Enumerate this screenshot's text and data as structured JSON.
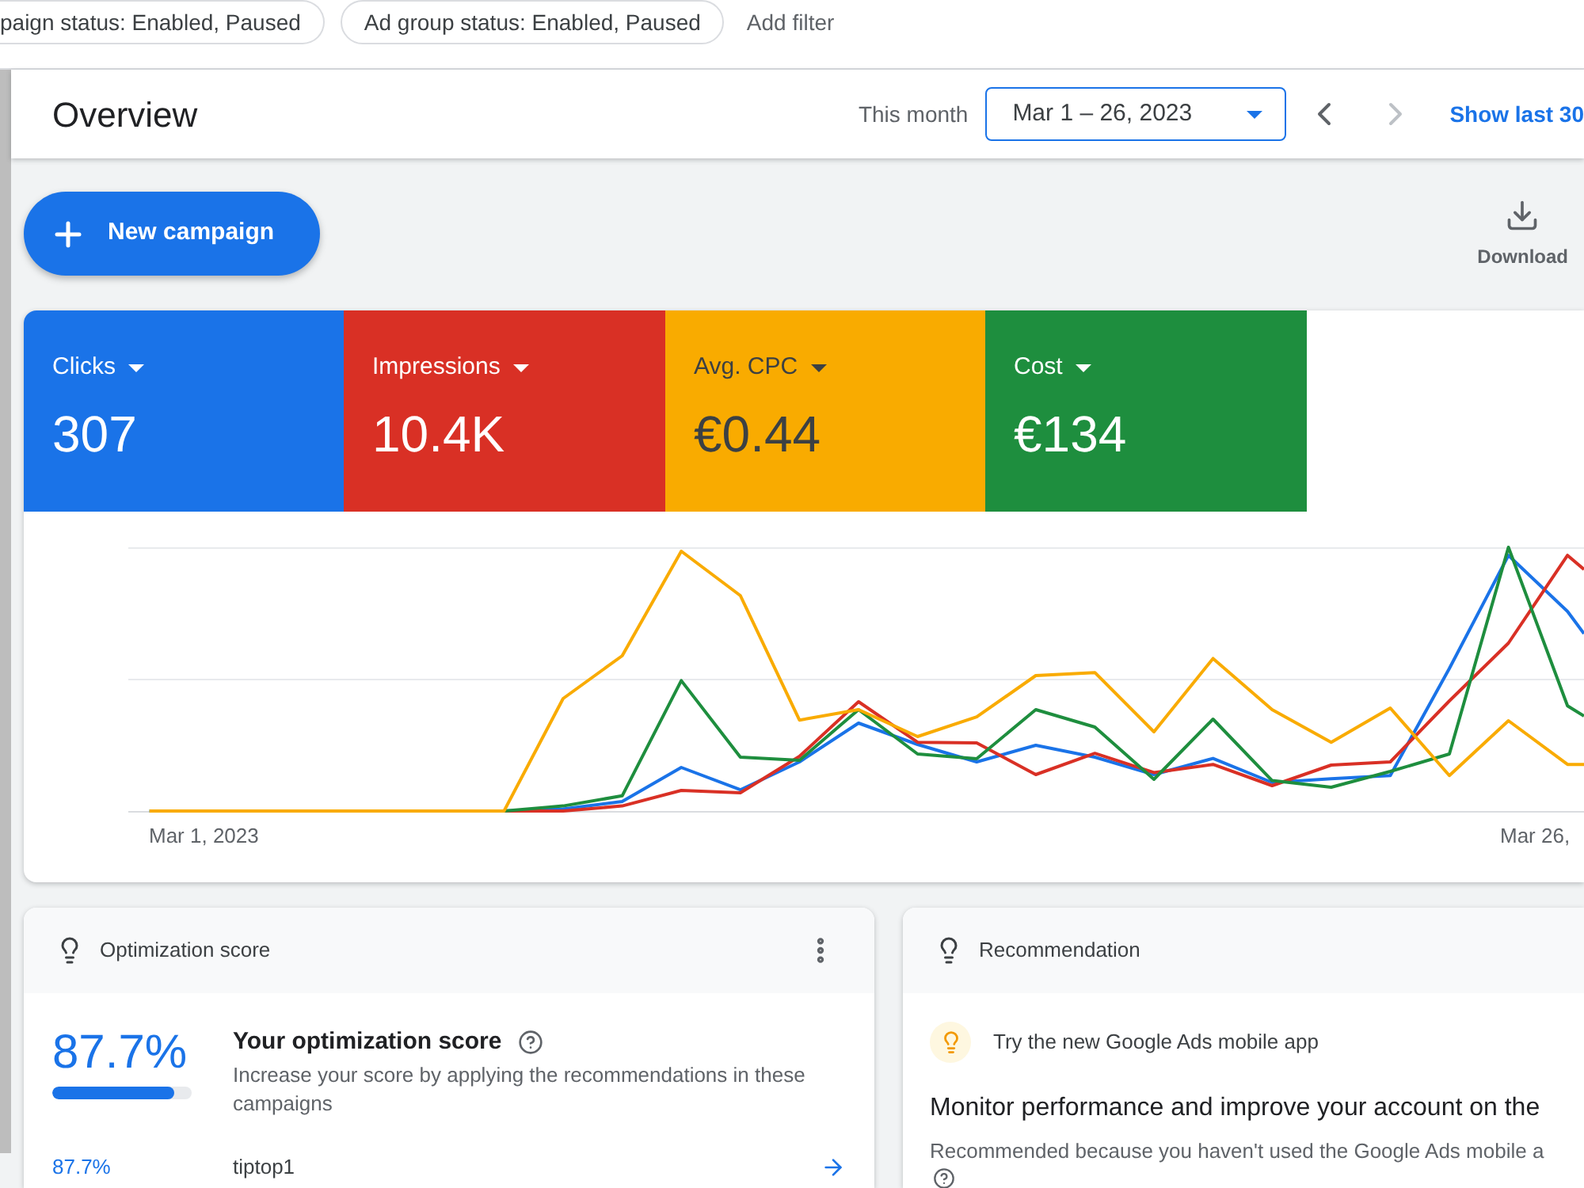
{
  "filters": [
    {
      "label": "paign status: Enabled, Paused"
    },
    {
      "label": "Ad group status: Enabled, Paused"
    }
  ],
  "add_filter": "Add filter",
  "header": {
    "title": "Overview",
    "range_label": "This month",
    "date_range": "Mar 1 – 26, 2023",
    "prev_disabled": false,
    "next_disabled": true,
    "show_last": "Show last 30"
  },
  "toolbar": {
    "new_campaign": "New campaign",
    "download": "Download"
  },
  "metrics": [
    {
      "label": "Clicks",
      "value": "307",
      "color": "#1a73e8",
      "selected": true
    },
    {
      "label": "Impressions",
      "value": "10.4K",
      "color": "#d93025",
      "selected": true
    },
    {
      "label": "Avg. CPC",
      "value": "€0.44",
      "color": "#f9ab00",
      "selected": true
    },
    {
      "label": "Cost",
      "value": "€134",
      "color": "#1e8e3e",
      "selected": true
    }
  ],
  "chart": {
    "x_labels": [
      "Mar 1, 2023",
      "Mar 26,"
    ]
  },
  "optimization_card": {
    "title": "Optimization score",
    "score": "87.7%",
    "level": 0.877,
    "heading": "Your optimization score",
    "description": "Increase your score by applying the recommendations in these campaigns",
    "campaigns": [
      {
        "score": "87.7%",
        "name": "tiptop1"
      }
    ]
  },
  "recommendation_card": {
    "title": "Recommendation",
    "tip": "Try the new Google Ads mobile app",
    "heading": "Monitor performance and improve your account on the",
    "reason": "Recommended because you haven't used the Google Ads mobile a"
  }
}
